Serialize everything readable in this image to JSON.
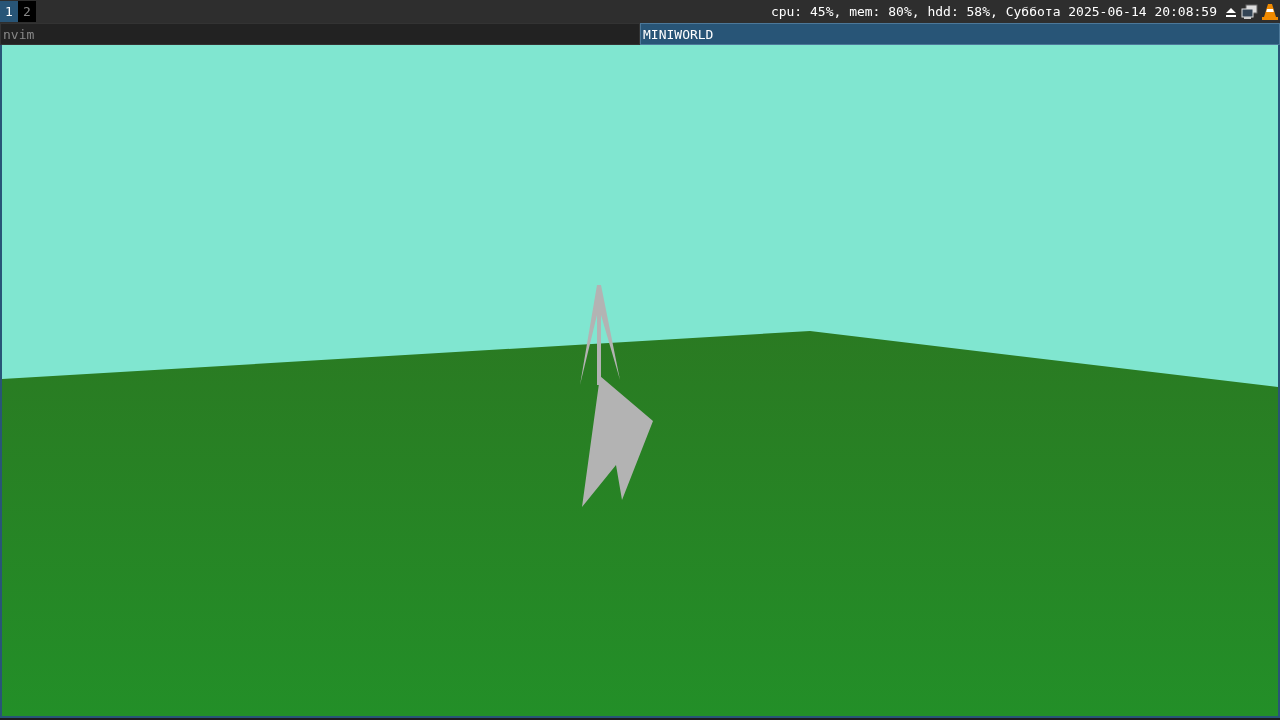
{
  "workspaces": [
    {
      "label": "1",
      "selected": true
    },
    {
      "label": "2",
      "selected": false
    }
  ],
  "status_bar": {
    "text": "cpu: 45%, mem: 80%, hdd: 58%, Суббота 2025-06-14 20:08:59"
  },
  "window_tabs": [
    {
      "title": "nvim",
      "selected": false
    },
    {
      "title": "MINIWORLD",
      "selected": true
    }
  ]
}
